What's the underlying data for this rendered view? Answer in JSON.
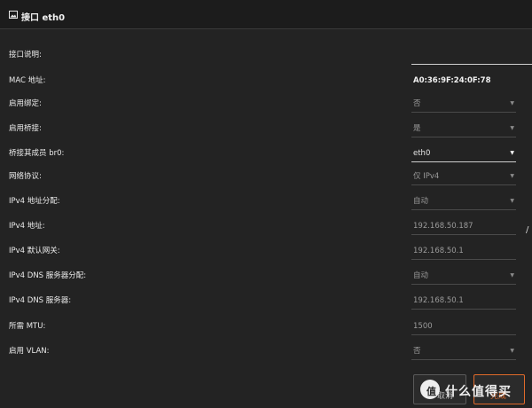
{
  "header": {
    "title": "接口 eth0",
    "icon": "image-icon"
  },
  "fields": [
    {
      "key": "desc",
      "label": "接口说明:",
      "type": "text",
      "value": ""
    },
    {
      "key": "mac",
      "label": "MAC 地址:",
      "type": "static",
      "value": "A0:36:9F:24:0F:78"
    },
    {
      "key": "bind",
      "label": "启用绑定:",
      "type": "select",
      "value": "否"
    },
    {
      "key": "bridge",
      "label": "启用桥接:",
      "type": "select",
      "value": "是"
    },
    {
      "key": "bridge_member",
      "label": "桥接其成员 br0:",
      "type": "select",
      "value": "eth0"
    },
    {
      "key": "protocol",
      "label": "网络协议:",
      "type": "select",
      "value": "仅 IPv4"
    },
    {
      "key": "ipv4_alloc",
      "label": "IPv4 地址分配:",
      "type": "select",
      "value": "自动"
    },
    {
      "key": "ipv4_addr",
      "label": "IPv4 地址:",
      "type": "text",
      "value": "192.168.50.187"
    },
    {
      "key": "ipv4_gw",
      "label": "IPv4 默认网关:",
      "type": "text",
      "value": "192.168.50.1"
    },
    {
      "key": "dns_alloc",
      "label": "IPv4 DNS 服务器分配:",
      "type": "select",
      "value": "自动"
    },
    {
      "key": "dns_server",
      "label": "IPv4 DNS 服务器:",
      "type": "text",
      "value": "192.168.50.1"
    },
    {
      "key": "mtu",
      "label": "所需 MTU:",
      "type": "text",
      "value": "1500"
    },
    {
      "key": "vlan",
      "label": "启用 VLAN:",
      "type": "select",
      "value": "否"
    }
  ],
  "ipv4_prefix_separator": "/",
  "buttons": {
    "cancel": "取消",
    "done": "完成"
  },
  "watermark": {
    "logo": "值",
    "text": "什么值得买"
  },
  "colors": {
    "background": "#232323",
    "accent": "#e06a2a"
  }
}
